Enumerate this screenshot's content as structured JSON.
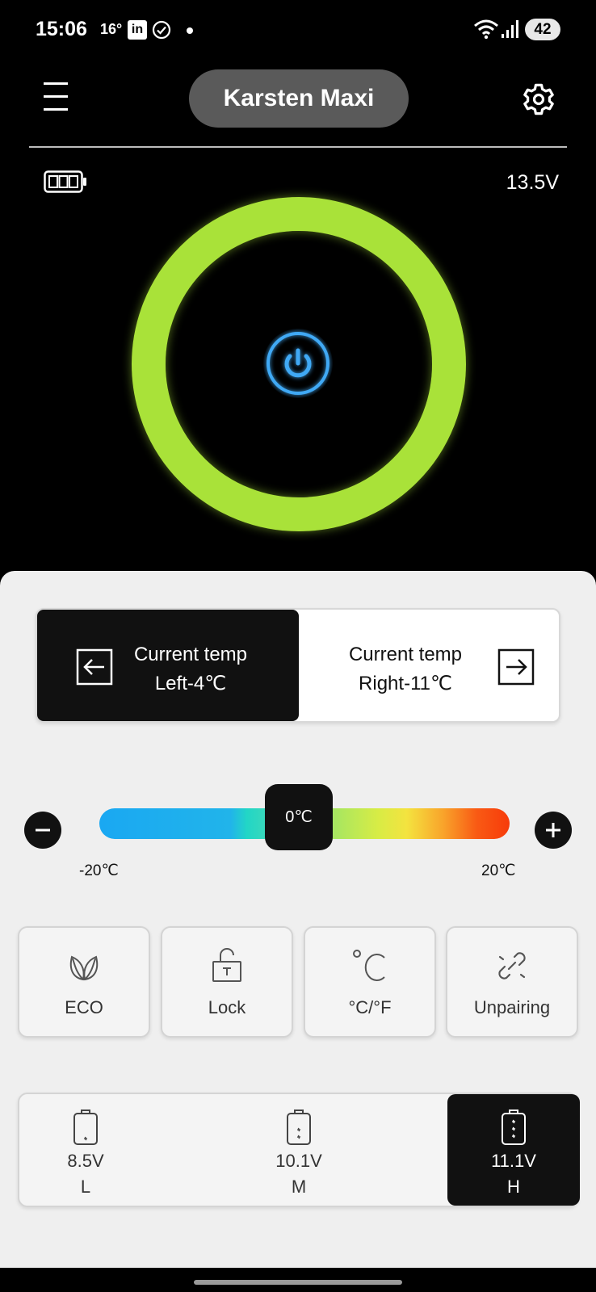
{
  "status_bar": {
    "time": "15:06",
    "weather": "16°",
    "linkedin_badge": "in",
    "battery_level": "42"
  },
  "header": {
    "device_name": "Karsten Maxi",
    "voltage": "13.5V"
  },
  "ring": {
    "ring_color": "#a9e239",
    "power_color": "#3fa9f5"
  },
  "zones": {
    "left": {
      "line1": "Current temp",
      "line2": "Left-4℃",
      "selected": true
    },
    "right": {
      "line1": "Current temp",
      "line2": "Right-11℃",
      "selected": false
    }
  },
  "temperature_slider": {
    "value_label": "0℃",
    "min_label": "-20℃",
    "max_label": "20℃",
    "value": 0,
    "min": -20,
    "max": 20
  },
  "functions": [
    {
      "label": "ECO",
      "icon": "leaf-icon"
    },
    {
      "label": "Lock",
      "icon": "lock-icon"
    },
    {
      "label": "°C/°F",
      "icon": "celsius-icon"
    },
    {
      "label": "Unpairing",
      "icon": "unlink-icon"
    }
  ],
  "battery_protection": [
    {
      "voltage": "8.5V",
      "level": "L",
      "selected": false
    },
    {
      "voltage": "10.1V",
      "level": "M",
      "selected": false
    },
    {
      "voltage": "11.1V",
      "level": "H",
      "selected": true
    }
  ]
}
